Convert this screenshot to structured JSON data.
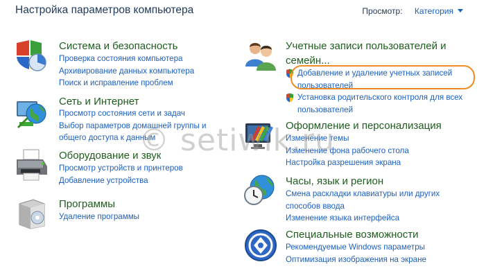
{
  "header": {
    "title": "Настройка параметров компьютера",
    "view_label": "Просмотр:",
    "view_value": "Категория"
  },
  "categories": {
    "system": {
      "title": "Система и безопасность",
      "links": [
        "Проверка состояния компьютера",
        "Архивирование данных компьютера",
        "Поиск и исправление проблем"
      ]
    },
    "network": {
      "title": "Сеть и Интернет",
      "links": [
        "Просмотр состояния сети и задач",
        "Выбор параметров домашней группы и",
        "общего доступа к данным"
      ]
    },
    "hardware": {
      "title": "Оборудование и звук",
      "links": [
        "Просмотр устройств и принтеров",
        "Добавление устройства"
      ]
    },
    "programs": {
      "title": "Программы",
      "links": [
        "Удаление программы"
      ]
    },
    "users": {
      "title_line1": "Учетные записи пользователей и",
      "title_line2": "семейн...",
      "links": [
        "Добавление и удаление учетных записей",
        "пользователей",
        "Установка родительского контроля для всех",
        "пользователей"
      ]
    },
    "appearance": {
      "title": "Оформление и персонализация",
      "links": [
        "Изменение темы",
        "Изменение фона рабочего стола",
        "Настройка разрешения экрана"
      ]
    },
    "clock": {
      "title": "Часы, язык и регион",
      "links": [
        "Смена раскладки клавиатуры или других",
        "способов ввода",
        "Изменение языка интерфейса"
      ]
    },
    "access": {
      "title": "Специальные возможности",
      "links": [
        "Рекомендуемые Windows параметры",
        "Оптимизация изображения на экране"
      ]
    }
  },
  "watermark": "© setiwik.ru",
  "colors": {
    "title_text": "#1e395b",
    "category_text": "#1e5d1e",
    "link_text": "#1d5fbf",
    "highlight_outline": "#f08a24"
  }
}
